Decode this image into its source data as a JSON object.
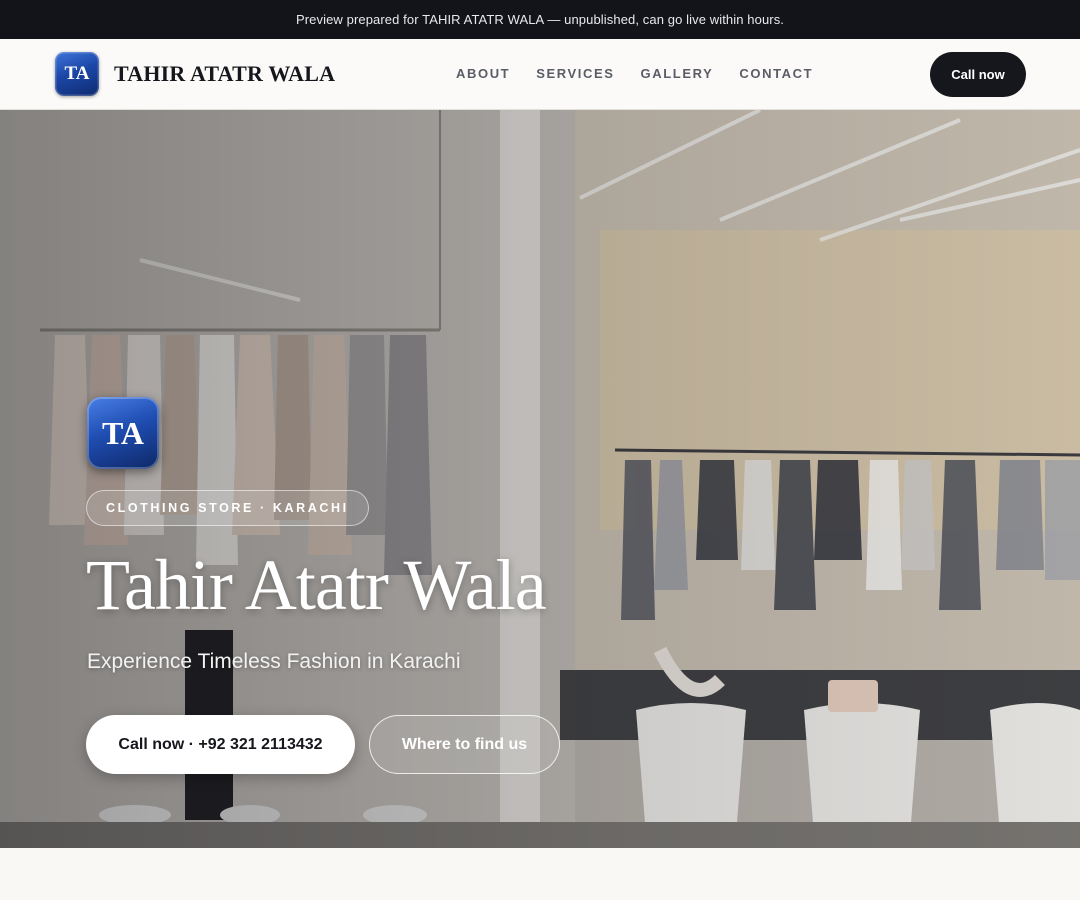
{
  "preview_banner": "Preview prepared for TAHIR ATATR WALA — unpublished, can go live within hours.",
  "brand": {
    "logo_initials": "TA",
    "name": "TAHIR ATATR WALA"
  },
  "nav": [
    {
      "label": "ABOUT"
    },
    {
      "label": "SERVICES"
    },
    {
      "label": "GALLERY"
    },
    {
      "label": "CONTACT"
    }
  ],
  "header_cta": "Call now",
  "hero": {
    "logo_initials": "TA",
    "tag": "CLOTHING STORE · KARACHI",
    "title": "Tahir Atatr Wala",
    "subtitle": "Experience Timeless Fashion in Karachi",
    "primary_button": "Call now · +92 321 2113432",
    "secondary_button": "Where to find us",
    "background_image": "clothing-store-interior-photo"
  },
  "colors": {
    "dark": "#12141a",
    "logo_blue": "#1c47a8",
    "page_bg": "#f9f8f5"
  }
}
